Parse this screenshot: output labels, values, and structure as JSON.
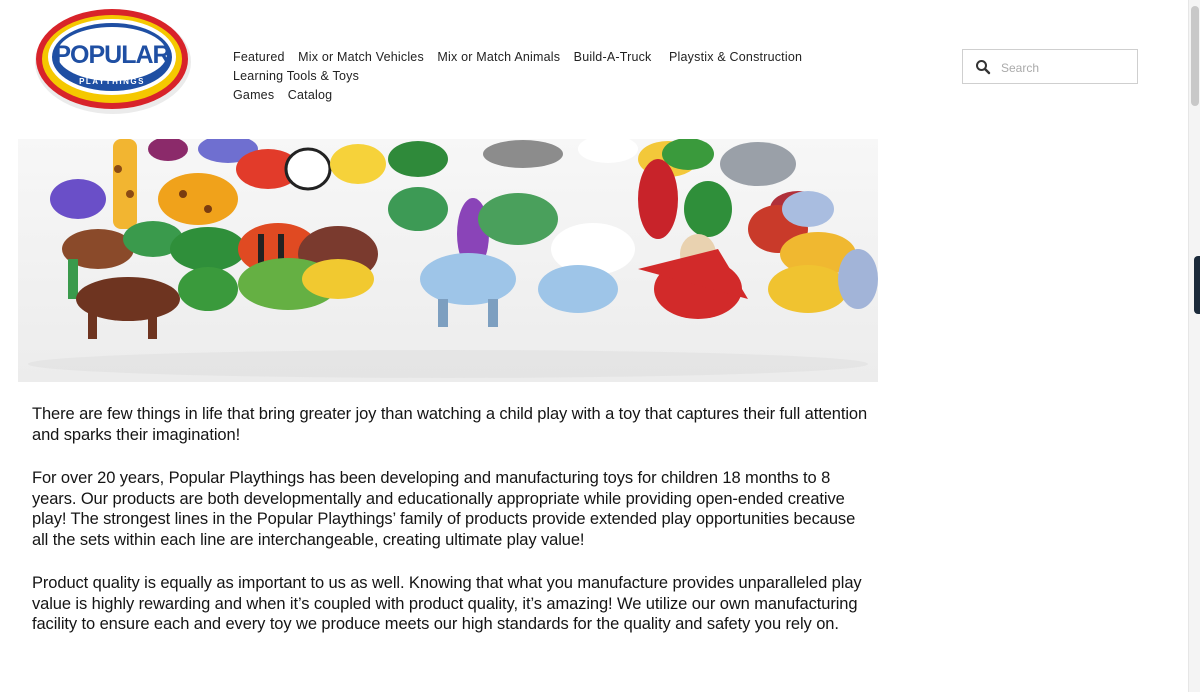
{
  "brand": {
    "logo_main": "POPULAR",
    "logo_sub": "PLAYTHINGS"
  },
  "nav": {
    "row1": [
      "Featured",
      "Mix or Match Vehicles",
      "Mix or Match Animals",
      "Build-A-Truck",
      "Playstix & Construction",
      "Learning Tools & Toys"
    ],
    "row2": [
      "Games",
      "Catalog"
    ]
  },
  "search": {
    "placeholder": "Search"
  },
  "hero": {
    "subject": "toy-animals-photo"
  },
  "paragraphs": [
    "There are few things in life that bring greater joy than watching a child play with a toy that captures their full attention and sparks their imagination!",
    "For over 20 years, Popular Playthings has been developing and manufacturing toys for children 18 months to 8 years. Our products are both developmentally and educationally appropriate while providing open-ended creative play! The strongest lines in the Popular Playthings’ family of products provide extended play opportunities because all the sets within each line are interchangeable, creating ultimate play value!",
    "Product quality is equally as important to us as well. Knowing that what you manufacture provides unparalleled play value is highly rewarding and when it’s coupled with product quality, it’s amazing! We utilize our own manufacturing facility to ensure each and every toy we produce meets our high standards for the quality and safety you rely on."
  ],
  "colors": {
    "logo_red": "#d8232a",
    "logo_yellow": "#f5c800",
    "logo_blue": "#1f4fa3"
  }
}
